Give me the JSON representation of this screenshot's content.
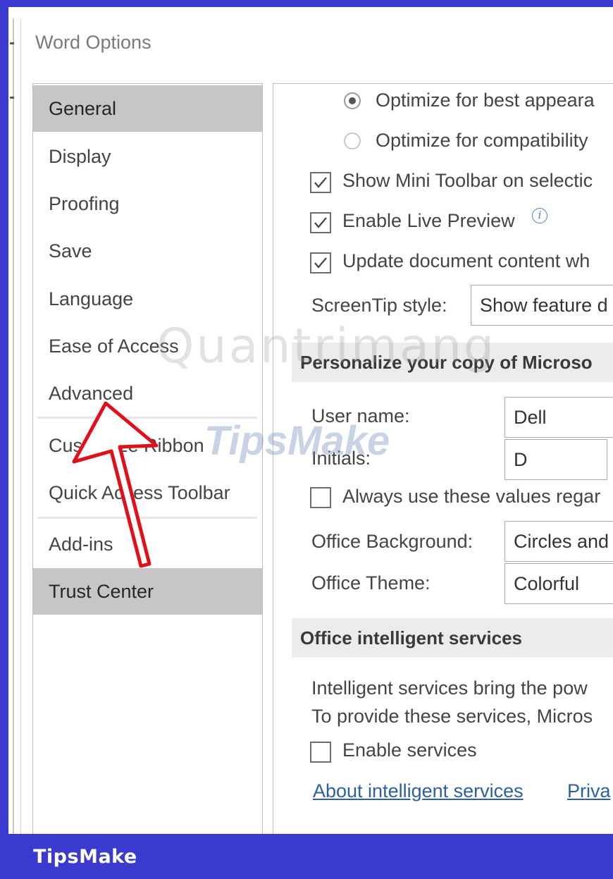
{
  "window": {
    "title": "Word Options"
  },
  "sidebar": {
    "items": [
      {
        "label": "General",
        "selected": true
      },
      {
        "label": "Display",
        "selected": false
      },
      {
        "label": "Proofing",
        "selected": false
      },
      {
        "label": "Save",
        "selected": false
      },
      {
        "label": "Language",
        "selected": false
      },
      {
        "label": "Ease of Access",
        "selected": false
      },
      {
        "label": "Advanced",
        "selected": false
      },
      {
        "label": "Customize Ribbon",
        "selected": false
      },
      {
        "label": "Quick Access Toolbar",
        "selected": false
      },
      {
        "label": "Add-ins",
        "selected": false
      },
      {
        "label": "Trust Center",
        "selected": true
      }
    ]
  },
  "content": {
    "radio_best": {
      "label": "Optimize for best appeara",
      "checked": true
    },
    "radio_compat": {
      "label": "Optimize for compatibility",
      "checked": false
    },
    "mini_toolbar": {
      "label": "Show Mini Toolbar on selectic",
      "checked": true
    },
    "live_preview": {
      "label": "Enable Live Preview",
      "checked": true
    },
    "update_content": {
      "label": "Update document content wh",
      "checked": true
    },
    "screentip": {
      "label": "ScreenTip style:",
      "value": "Show feature d"
    },
    "personalize": {
      "heading": "Personalize your copy of Microso",
      "user_name_label": "User name:",
      "user_name_value": "Dell",
      "initials_label": "Initials:",
      "initials_value": "D",
      "always_use": {
        "label": "Always use these values regar",
        "checked": false
      },
      "background_label": "Office Background:",
      "background_value": "Circles and",
      "theme_label": "Office Theme:",
      "theme_value": "Colorful"
    },
    "intelligent": {
      "heading": "Office intelligent services",
      "line1": "Intelligent services bring the pow",
      "line2": "To provide these services, Micros",
      "enable": {
        "label": "Enable services",
        "checked": false
      },
      "about_link": "About intelligent services",
      "privacy_link": "Priva"
    }
  },
  "overlay": {
    "watermark": "Quantrimang",
    "watermark2": "TipsMake",
    "brand": "TipsMake"
  },
  "colors": {
    "frame": "#3a3acf",
    "selected": "#c6c6c6",
    "arrow": "#e0101a",
    "link": "#2b5fa8"
  }
}
